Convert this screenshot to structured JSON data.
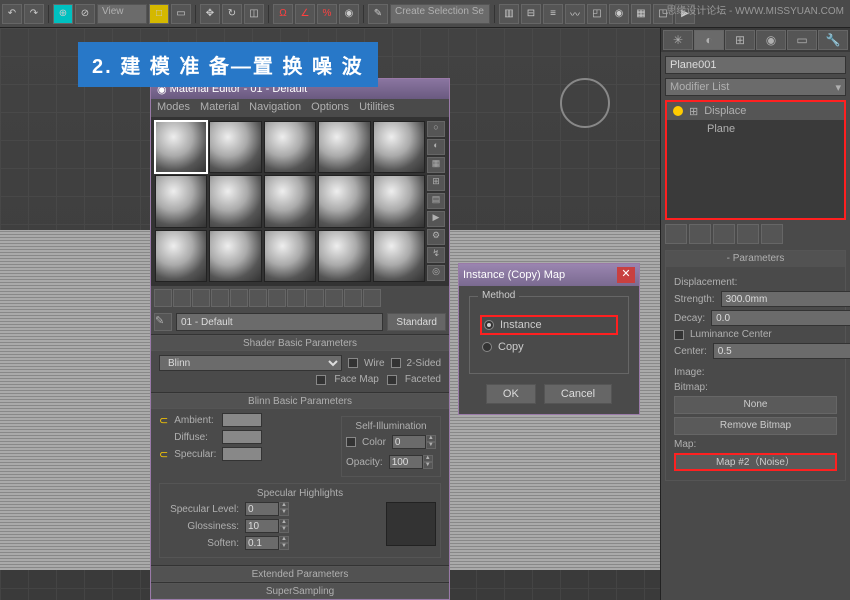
{
  "watermark": "思缘设计论坛 - WWW.MISSYUAN.COM",
  "tutorial_callout": "2. 建 模 准 备—置 换 噪 波",
  "toolbar": {
    "view_label": "View",
    "sel_dropdown": "Create Selection Se"
  },
  "material_editor": {
    "title": "Material Editor - 01 - Default",
    "menu": [
      "Modes",
      "Material",
      "Navigation",
      "Options",
      "Utilities"
    ],
    "name": "01 - Default",
    "type_btn": "Standard",
    "rollouts": {
      "shader_basic": "Shader Basic Parameters",
      "shader_type": "Blinn",
      "wire": "Wire",
      "two_sided": "2-Sided",
      "face_map": "Face Map",
      "faceted": "Faceted",
      "blinn_basic": "Blinn Basic Parameters",
      "self_illum": "Self-Illumination",
      "ambient": "Ambient:",
      "diffuse": "Diffuse:",
      "specular": "Specular:",
      "color": "Color",
      "color_val": "0",
      "opacity": "Opacity:",
      "opacity_val": "100",
      "spec_highlights": "Specular Highlights",
      "spec_level": "Specular Level:",
      "spec_level_val": "0",
      "glossiness": "Glossiness:",
      "glossiness_val": "10",
      "soften": "Soften:",
      "soften_val": "0.1",
      "extended": "Extended Parameters",
      "supersampling": "SuperSampling"
    }
  },
  "instance_dialog": {
    "title": "Instance (Copy) Map",
    "method": "Method",
    "instance": "Instance",
    "copy": "Copy",
    "ok": "OK",
    "cancel": "Cancel"
  },
  "command_panel": {
    "object_name": "Plane001",
    "modifier_list": "Modifier List",
    "mod_displace": "Displace",
    "mod_plane": "Plane",
    "parameters": "Parameters",
    "displacement": "Displacement:",
    "strength": "Strength:",
    "strength_val": "300.0mm",
    "decay": "Decay:",
    "decay_val": "0.0",
    "lum_center": "Luminance Center",
    "center": "Center:",
    "center_val": "0.5",
    "image": "Image:",
    "bitmap": "Bitmap:",
    "none": "None",
    "remove_bitmap": "Remove Bitmap",
    "map": "Map:",
    "map_btn": "Map #2（Noise）"
  }
}
